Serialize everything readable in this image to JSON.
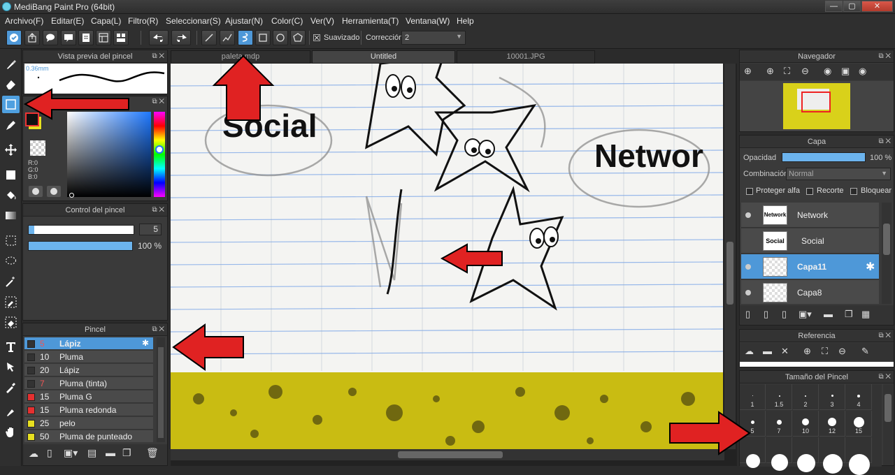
{
  "window": {
    "title": "MediBang Paint Pro (64bit)",
    "min": "—",
    "max": "▢",
    "close": "✕"
  },
  "menu": [
    "Archivo(F)",
    "Editar(E)",
    "Capa(L)",
    "Filtro(R)",
    "Seleccionar(S)",
    "Ajustar(N)",
    "Color(C)",
    "Ver(V)",
    "Herramienta(T)",
    "Ventana(W)",
    "Help"
  ],
  "toolbar": {
    "smooth_label": "Suavizado",
    "correction_label": "Corrección",
    "correction_value": "2"
  },
  "brush_preview": {
    "title": "Vista previa del pincel",
    "size_text": "0.36mm"
  },
  "color": {
    "r": "R:0",
    "g": "G:0",
    "b": "B:0"
  },
  "brush_control": {
    "title": "Control del pincel",
    "size": "5",
    "opacity": "100 %",
    "size_fraction": 0.05,
    "opacity_fraction": 1.0
  },
  "brush_list": {
    "title": "Pincel",
    "items": [
      {
        "size": "5",
        "name": "Lápiz",
        "color": "#333333",
        "selected": true
      },
      {
        "size": "10",
        "name": "Pluma",
        "color": "#333333"
      },
      {
        "size": "20",
        "name": "Lápiz",
        "color": "#333333"
      },
      {
        "size": "7",
        "name": "Pluma (tinta)",
        "color": "#333333"
      },
      {
        "size": "15",
        "name": "Pluma G",
        "color": "#e53030"
      },
      {
        "size": "15",
        "name": "Pluma redonda",
        "color": "#e53030"
      },
      {
        "size": "25",
        "name": "pelo",
        "color": "#e8e020"
      },
      {
        "size": "50",
        "name": "Pluma de punteado",
        "color": "#e8e020"
      }
    ]
  },
  "tabs": [
    "paleta.mdp",
    "Untitled",
    "10001.JPG"
  ],
  "canvas": {
    "text_social": "Social",
    "text_network": "Networ"
  },
  "navigator": {
    "title": "Navegador"
  },
  "layers": {
    "title": "Capa",
    "opacity_label": "Opacidad",
    "opacity_value": "100 %",
    "opacity_fraction": 1.0,
    "blend_label": "Combinación",
    "blend_value": "Normal",
    "protect_alpha": "Proteger alfa",
    "clip": "Recorte",
    "lock": "Bloquear",
    "items": [
      {
        "name": "Network",
        "thumb": "Network"
      },
      {
        "name": "Social",
        "thumb": "Social"
      },
      {
        "name": "Capa11",
        "thumb": "",
        "selected": true
      },
      {
        "name": "Capa8",
        "thumb": ""
      }
    ]
  },
  "reference": {
    "title": "Referencia"
  },
  "brush_size": {
    "title": "Tamaño del Pincel",
    "row1": [
      "1",
      "1.5",
      "2",
      "3",
      "4"
    ],
    "row2": [
      "5",
      "7",
      "10",
      "12",
      "15"
    ]
  },
  "accent": "#4e98d8"
}
